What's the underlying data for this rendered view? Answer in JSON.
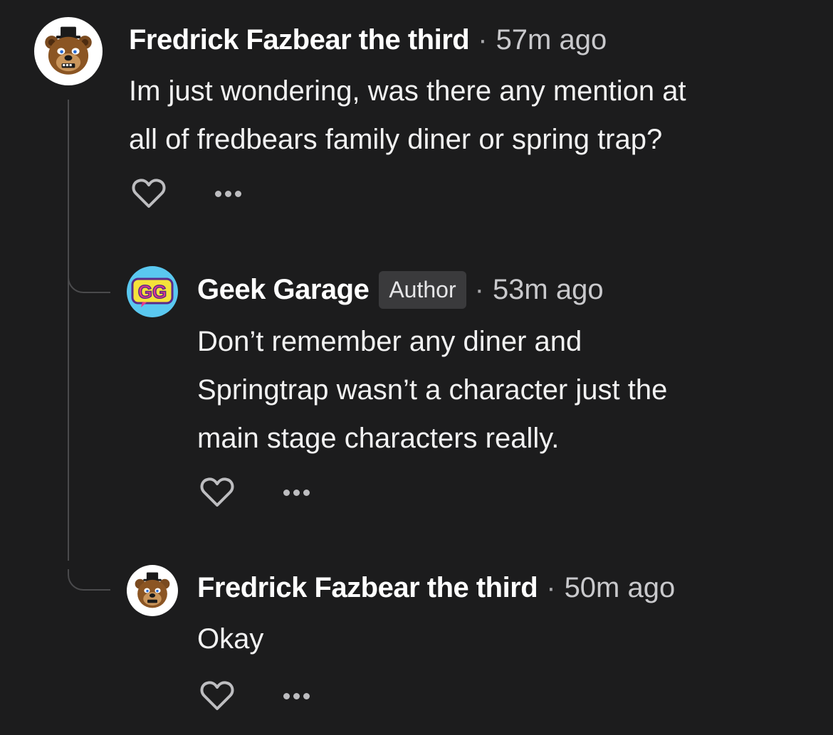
{
  "comments": [
    {
      "author": "Fredrick Fazbear the third",
      "separator": "·",
      "time": "57m ago",
      "text_lines": [
        "Im just wondering, was there any mention at",
        "all of fredbears family diner or spring trap?"
      ],
      "avatar": "freddy-bear-avatar"
    },
    {
      "author": "Geek Garage",
      "badge": "Author",
      "separator": "·",
      "time": "53m ago",
      "text_lines": [
        "Don’t remember any diner and",
        "Springtrap wasn’t a character just the",
        "main stage characters really."
      ],
      "avatar": "gg-logo-avatar",
      "avatar_text": "GG"
    },
    {
      "author": "Fredrick Fazbear the third",
      "separator": "·",
      "time": "50m ago",
      "text_lines": [
        "Okay"
      ],
      "avatar": "freddy-bear-avatar"
    }
  ],
  "icons": {
    "like": "heart-icon",
    "more": "more-options-icon"
  },
  "colors": {
    "background": "#1c1c1d",
    "text": "#f2f2f2",
    "muted": "#c9c9cc",
    "badge_bg": "#3a3a3c",
    "thread_line": "#4a4a4c"
  }
}
